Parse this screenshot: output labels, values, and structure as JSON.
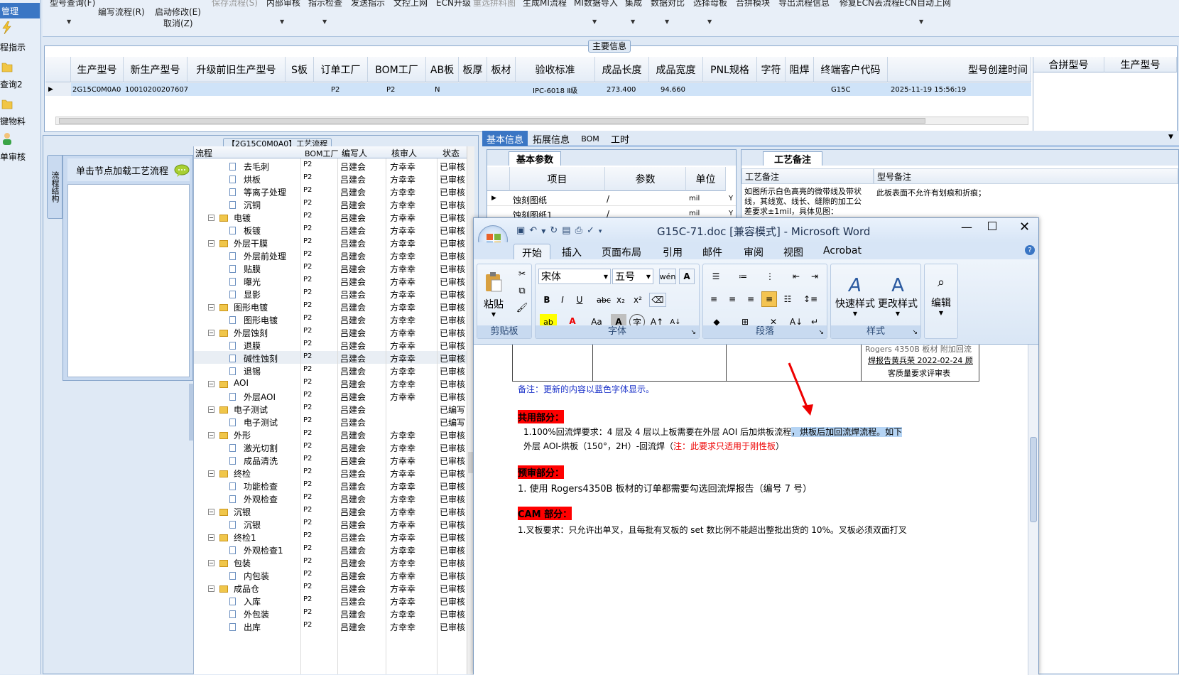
{
  "leftnav": {
    "selected": "管理",
    "items": [
      {
        "label": "程指示",
        "icon": "lightning-icon"
      },
      {
        "label": "查询2",
        "icon": "folder-icon"
      },
      {
        "label": "键物料",
        "icon": "folder-icon"
      },
      {
        "label": "单审核",
        "icon": "user-icon"
      }
    ]
  },
  "toolbar": {
    "row1": [
      "型号查询(F)",
      "保存流程(S)",
      "内部审核",
      "指示检查",
      "发送指示",
      "文控上网",
      "ECN升级",
      "重选拼料图",
      "生成MI流程",
      "MI数据导入",
      "集成",
      "数据对比",
      "选择母板",
      "合拼模块",
      "导出流程信息",
      "修复ECN丢流程",
      "ECN自动上网"
    ],
    "write_flow": "编写流程(R)",
    "start_modify": "启动修改(E)",
    "cancel": "取消(Z)"
  },
  "main_info": {
    "title": "主要信息",
    "columns": [
      "生产型号",
      "新生产型号",
      "升级前旧生产型号",
      "S板",
      "订单工厂",
      "BOM工厂",
      "AB板",
      "板厚",
      "板材",
      "验收标准",
      "成品长度",
      "成品宽度",
      "PNL规格",
      "字符",
      "阻焊",
      "终端客户代码",
      "型号创建时间"
    ],
    "row": [
      "2G15C0M0A0",
      "10010200207607",
      "",
      "",
      "P2",
      "P2",
      "N",
      "",
      "",
      "IPC-6018 Ⅱ级",
      "273.400",
      "94.660",
      "",
      "",
      "",
      "G15C",
      "2025-11-19 15:56:19"
    ],
    "merge_columns": [
      "合拼型号",
      "生产型号"
    ]
  },
  "process": {
    "title": "【2G15C0M0A0】工艺流程",
    "side_tab": "流程结构",
    "load_hint": "单击节点加载工艺流程",
    "columns": [
      "流程",
      "BOM工厂",
      "编写人",
      "核审人",
      "状态"
    ],
    "rows": [
      {
        "name": "去毛刺",
        "type": "leaf",
        "bom": "P2",
        "writer": "吕建会",
        "reviewer": "方幸幸",
        "status": "已审核"
      },
      {
        "name": "烘板",
        "type": "leaf",
        "bom": "P2",
        "writer": "吕建会",
        "reviewer": "方幸幸",
        "status": "已审核"
      },
      {
        "name": "等离子处理",
        "type": "leaf",
        "bom": "P2",
        "writer": "吕建会",
        "reviewer": "方幸幸",
        "status": "已审核"
      },
      {
        "name": "沉铜",
        "type": "leaf",
        "bom": "P2",
        "writer": "吕建会",
        "reviewer": "方幸幸",
        "status": "已审核"
      },
      {
        "name": "电镀",
        "type": "folder",
        "bom": "P2",
        "writer": "吕建会",
        "reviewer": "方幸幸",
        "status": "已审核"
      },
      {
        "name": "板镀",
        "type": "leaf",
        "bom": "P2",
        "writer": "吕建会",
        "reviewer": "方幸幸",
        "status": "已审核"
      },
      {
        "name": "外层干膜",
        "type": "folder",
        "bom": "P2",
        "writer": "吕建会",
        "reviewer": "方幸幸",
        "status": "已审核"
      },
      {
        "name": "外层前处理",
        "type": "leaf",
        "bom": "P2",
        "writer": "吕建会",
        "reviewer": "方幸幸",
        "status": "已审核"
      },
      {
        "name": "贴膜",
        "type": "leaf",
        "bom": "P2",
        "writer": "吕建会",
        "reviewer": "方幸幸",
        "status": "已审核"
      },
      {
        "name": "曝光",
        "type": "leaf",
        "bom": "P2",
        "writer": "吕建会",
        "reviewer": "方幸幸",
        "status": "已审核"
      },
      {
        "name": "显影",
        "type": "leaf",
        "bom": "P2",
        "writer": "吕建会",
        "reviewer": "方幸幸",
        "status": "已审核"
      },
      {
        "name": "图形电镀",
        "type": "folder",
        "bom": "P2",
        "writer": "吕建会",
        "reviewer": "方幸幸",
        "status": "已审核"
      },
      {
        "name": "图形电镀",
        "type": "leaf",
        "bom": "P2",
        "writer": "吕建会",
        "reviewer": "方幸幸",
        "status": "已审核"
      },
      {
        "name": "外层蚀刻",
        "type": "folder",
        "bom": "P2",
        "writer": "吕建会",
        "reviewer": "方幸幸",
        "status": "已审核"
      },
      {
        "name": "退膜",
        "type": "leaf",
        "bom": "P2",
        "writer": "吕建会",
        "reviewer": "方幸幸",
        "status": "已审核"
      },
      {
        "name": "碱性蚀刻",
        "type": "leaf",
        "bom": "P2",
        "writer": "吕建会",
        "reviewer": "方幸幸",
        "status": "已审核"
      },
      {
        "name": "退锡",
        "type": "leaf",
        "bom": "P2",
        "writer": "吕建会",
        "reviewer": "方幸幸",
        "status": "已审核"
      },
      {
        "name": "AOI",
        "type": "folder",
        "bom": "P2",
        "writer": "吕建会",
        "reviewer": "方幸幸",
        "status": "已审核"
      },
      {
        "name": "外层AOI",
        "type": "leaf",
        "bom": "P2",
        "writer": "吕建会",
        "reviewer": "方幸幸",
        "status": "已审核"
      },
      {
        "name": "电子测试",
        "type": "folder",
        "bom": "P2",
        "writer": "吕建会",
        "reviewer": "",
        "status": "已编写"
      },
      {
        "name": "电子测试",
        "type": "leaf",
        "bom": "P2",
        "writer": "吕建会",
        "reviewer": "",
        "status": "已编写"
      },
      {
        "name": "外形",
        "type": "folder",
        "bom": "P2",
        "writer": "吕建会",
        "reviewer": "方幸幸",
        "status": "已审核"
      },
      {
        "name": "激光切割",
        "type": "leaf",
        "bom": "P2",
        "writer": "吕建会",
        "reviewer": "方幸幸",
        "status": "已审核"
      },
      {
        "name": "成品清洗",
        "type": "leaf",
        "bom": "P2",
        "writer": "吕建会",
        "reviewer": "方幸幸",
        "status": "已审核"
      },
      {
        "name": "终检",
        "type": "folder",
        "bom": "P2",
        "writer": "吕建会",
        "reviewer": "方幸幸",
        "status": "已审核"
      },
      {
        "name": "功能检查",
        "type": "leaf",
        "bom": "P2",
        "writer": "吕建会",
        "reviewer": "方幸幸",
        "status": "已审核"
      },
      {
        "name": "外观检查",
        "type": "leaf",
        "bom": "P2",
        "writer": "吕建会",
        "reviewer": "方幸幸",
        "status": "已审核"
      },
      {
        "name": "沉银",
        "type": "folder",
        "bom": "P2",
        "writer": "吕建会",
        "reviewer": "方幸幸",
        "status": "已审核"
      },
      {
        "name": "沉银",
        "type": "leaf",
        "bom": "P2",
        "writer": "吕建会",
        "reviewer": "方幸幸",
        "status": "已审核"
      },
      {
        "name": "终检1",
        "type": "folder",
        "bom": "P2",
        "writer": "吕建会",
        "reviewer": "方幸幸",
        "status": "已审核"
      },
      {
        "name": "外观检查1",
        "type": "leaf",
        "bom": "P2",
        "writer": "吕建会",
        "reviewer": "方幸幸",
        "status": "已审核"
      },
      {
        "name": "包装",
        "type": "folder",
        "bom": "P2",
        "writer": "吕建会",
        "reviewer": "方幸幸",
        "status": "已审核"
      },
      {
        "name": "内包装",
        "type": "leaf",
        "bom": "P2",
        "writer": "吕建会",
        "reviewer": "方幸幸",
        "status": "已审核"
      },
      {
        "name": "成品仓",
        "type": "folder",
        "bom": "P2",
        "writer": "吕建会",
        "reviewer": "方幸幸",
        "status": "已审核"
      },
      {
        "name": "入库",
        "type": "leaf",
        "bom": "P2",
        "writer": "吕建会",
        "reviewer": "方幸幸",
        "status": "已审核"
      },
      {
        "name": "外包装",
        "type": "leaf",
        "bom": "P2",
        "writer": "吕建会",
        "reviewer": "方幸幸",
        "status": "已审核"
      },
      {
        "name": "出库",
        "type": "leaf",
        "bom": "P2",
        "writer": "吕建会",
        "reviewer": "方幸幸",
        "status": "已审核"
      }
    ]
  },
  "right": {
    "tabs": [
      "基本信息",
      "拓展信息",
      "BOM",
      "工时"
    ],
    "basic_tab": "基本参数",
    "remark_tab": "工艺备注",
    "param_columns": [
      "项目",
      "参数",
      "单位"
    ],
    "params": [
      {
        "item": "蚀刻图纸",
        "value": "/",
        "unit": "mil",
        "flag": "Y"
      },
      {
        "item": "蚀刻图纸1",
        "value": "/",
        "unit": "mil",
        "flag": "Y"
      }
    ],
    "remark_columns": [
      "工艺备注",
      "型号备注"
    ],
    "process_remark": "如图所示白色高亮的微带线及带状线，其线宽、线长、缝隙的加工公差要求±1mil，具体见图：",
    "model_remark": "此板表面不允许有划痕和折痕；"
  },
  "word": {
    "title": "G15C-71.doc [兼容模式] - Microsoft Word",
    "tabs": [
      "开始",
      "插入",
      "页面布局",
      "引用",
      "邮件",
      "审阅",
      "视图",
      "Acrobat"
    ],
    "font_name": "宋体",
    "font_size": "五号",
    "groups": [
      "剪贴板",
      "字体",
      "段落",
      "样式"
    ],
    "paste": "粘贴",
    "quick_style": "快速样式",
    "change_style": "更改样式",
    "edit": "编辑",
    "table_text": [
      "Rogers 4350B 板材 附加回流",
      "焊报告黄兵荣 2022-02-24 顾",
      "客质量要求评审表"
    ],
    "note": "备注：更新的内容以蓝色字体显示。",
    "common_title": "共用部分：",
    "common_line1a": "1.100%回流焊要求：4 层及 4 层以上板需要在外层 AOI 后加烘板流程",
    "common_line1b": "，烘板后加回流焊流程。如下",
    "common_line2": "外层 AOI-烘板（150°，2H）-回流焊（",
    "common_line2_red": "注：此要求只适用于刚性板",
    "common_line2_end": "）",
    "precheck_title": "预审部分：",
    "precheck_line": "1. 使用 Rogers4350B 板材的订单都需要勾选回流焊报告（编号 7 号）",
    "cam_title": "CAM 部分：",
    "cam_line": "1.叉板要求：只允许出单叉，且每批有叉板的 set 数比例不能超出整批出货的 10%。叉板必须双面打叉"
  }
}
